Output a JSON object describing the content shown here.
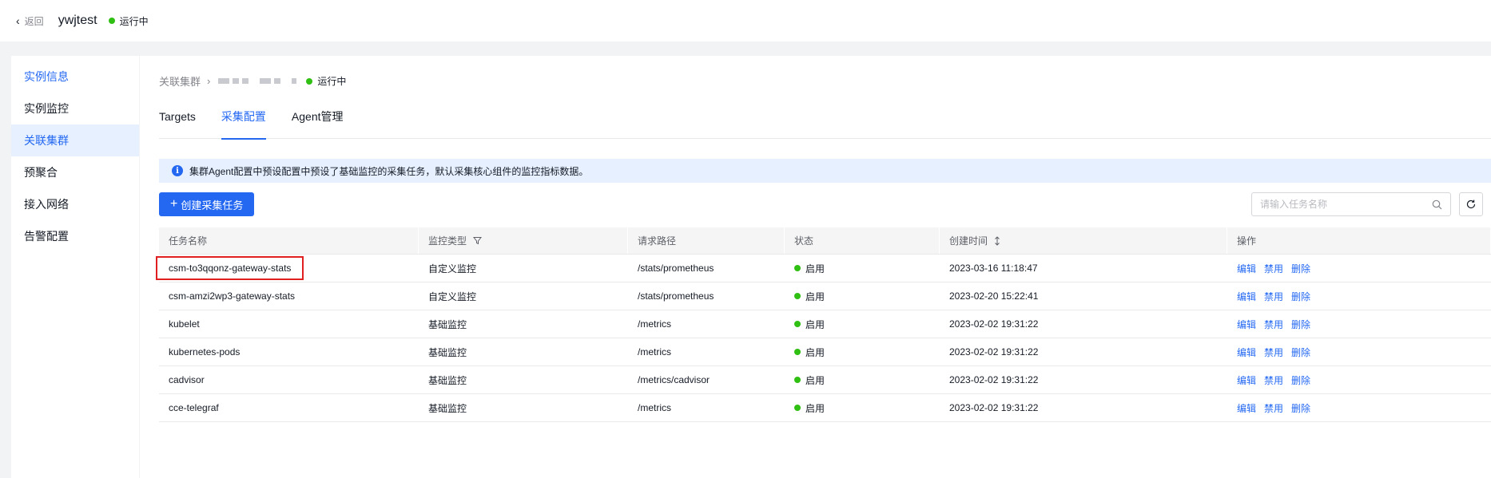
{
  "header": {
    "back_label": "返回",
    "instance_name": "ywjtest",
    "status": "运行中"
  },
  "sidebar": {
    "items": [
      {
        "label": "实例信息"
      },
      {
        "label": "实例监控"
      },
      {
        "label": "关联集群"
      },
      {
        "label": "预聚合"
      },
      {
        "label": "接入网络"
      },
      {
        "label": "告警配置"
      }
    ],
    "active": "关联集群"
  },
  "breadcrumb": {
    "root": "关联集群",
    "status": "运行中"
  },
  "tabs": [
    {
      "label": "Targets"
    },
    {
      "label": "采集配置"
    },
    {
      "label": "Agent管理"
    }
  ],
  "active_tab": "采集配置",
  "notice": "集群Agent配置中预设配置中预设了基础监控的采集任务，默认采集核心组件的监控指标数据。",
  "toolbar": {
    "create_label": "创建采集任务",
    "search_placeholder": "请输入任务名称"
  },
  "table": {
    "columns": [
      "任务名称",
      "监控类型",
      "请求路径",
      "状态",
      "创建时间",
      "操作"
    ],
    "rows": [
      {
        "name": "csm-to3qqonz-gateway-stats",
        "type": "自定义监控",
        "path": "/stats/prometheus",
        "status": "启用",
        "created": "2023-03-16 11:18:47"
      },
      {
        "name": "csm-amzi2wp3-gateway-stats",
        "type": "自定义监控",
        "path": "/stats/prometheus",
        "status": "启用",
        "created": "2023-02-20 15:22:41"
      },
      {
        "name": "kubelet",
        "type": "基础监控",
        "path": "/metrics",
        "status": "启用",
        "created": "2023-02-02 19:31:22"
      },
      {
        "name": "kubernetes-pods",
        "type": "基础监控",
        "path": "/metrics",
        "status": "启用",
        "created": "2023-02-02 19:31:22"
      },
      {
        "name": "cadvisor",
        "type": "基础监控",
        "path": "/metrics/cadvisor",
        "status": "启用",
        "created": "2023-02-02 19:31:22"
      },
      {
        "name": "cce-telegraf",
        "type": "基础监控",
        "path": "/metrics",
        "status": "启用",
        "created": "2023-02-02 19:31:22"
      }
    ],
    "actions": {
      "edit": "编辑",
      "disable": "禁用",
      "delete": "删除"
    }
  },
  "colors": {
    "accent": "#2468f2",
    "status_ok": "#30bf13",
    "highlight": "#e02020"
  }
}
